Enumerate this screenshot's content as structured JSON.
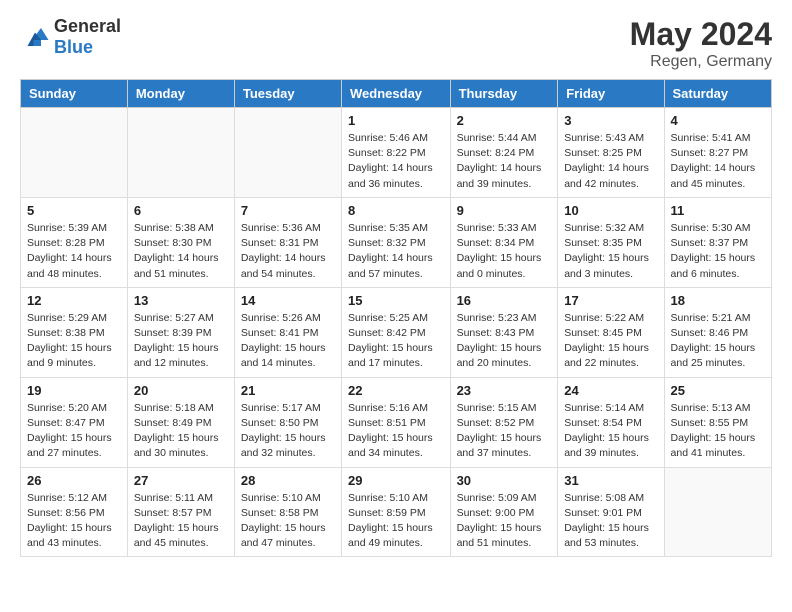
{
  "header": {
    "logo_general": "General",
    "logo_blue": "Blue",
    "month_year": "May 2024",
    "location": "Regen, Germany"
  },
  "weekdays": [
    "Sunday",
    "Monday",
    "Tuesday",
    "Wednesday",
    "Thursday",
    "Friday",
    "Saturday"
  ],
  "weeks": [
    [
      {
        "day": "",
        "info": ""
      },
      {
        "day": "",
        "info": ""
      },
      {
        "day": "",
        "info": ""
      },
      {
        "day": "1",
        "info": "Sunrise: 5:46 AM\nSunset: 8:22 PM\nDaylight: 14 hours\nand 36 minutes."
      },
      {
        "day": "2",
        "info": "Sunrise: 5:44 AM\nSunset: 8:24 PM\nDaylight: 14 hours\nand 39 minutes."
      },
      {
        "day": "3",
        "info": "Sunrise: 5:43 AM\nSunset: 8:25 PM\nDaylight: 14 hours\nand 42 minutes."
      },
      {
        "day": "4",
        "info": "Sunrise: 5:41 AM\nSunset: 8:27 PM\nDaylight: 14 hours\nand 45 minutes."
      }
    ],
    [
      {
        "day": "5",
        "info": "Sunrise: 5:39 AM\nSunset: 8:28 PM\nDaylight: 14 hours\nand 48 minutes."
      },
      {
        "day": "6",
        "info": "Sunrise: 5:38 AM\nSunset: 8:30 PM\nDaylight: 14 hours\nand 51 minutes."
      },
      {
        "day": "7",
        "info": "Sunrise: 5:36 AM\nSunset: 8:31 PM\nDaylight: 14 hours\nand 54 minutes."
      },
      {
        "day": "8",
        "info": "Sunrise: 5:35 AM\nSunset: 8:32 PM\nDaylight: 14 hours\nand 57 minutes."
      },
      {
        "day": "9",
        "info": "Sunrise: 5:33 AM\nSunset: 8:34 PM\nDaylight: 15 hours\nand 0 minutes."
      },
      {
        "day": "10",
        "info": "Sunrise: 5:32 AM\nSunset: 8:35 PM\nDaylight: 15 hours\nand 3 minutes."
      },
      {
        "day": "11",
        "info": "Sunrise: 5:30 AM\nSunset: 8:37 PM\nDaylight: 15 hours\nand 6 minutes."
      }
    ],
    [
      {
        "day": "12",
        "info": "Sunrise: 5:29 AM\nSunset: 8:38 PM\nDaylight: 15 hours\nand 9 minutes."
      },
      {
        "day": "13",
        "info": "Sunrise: 5:27 AM\nSunset: 8:39 PM\nDaylight: 15 hours\nand 12 minutes."
      },
      {
        "day": "14",
        "info": "Sunrise: 5:26 AM\nSunset: 8:41 PM\nDaylight: 15 hours\nand 14 minutes."
      },
      {
        "day": "15",
        "info": "Sunrise: 5:25 AM\nSunset: 8:42 PM\nDaylight: 15 hours\nand 17 minutes."
      },
      {
        "day": "16",
        "info": "Sunrise: 5:23 AM\nSunset: 8:43 PM\nDaylight: 15 hours\nand 20 minutes."
      },
      {
        "day": "17",
        "info": "Sunrise: 5:22 AM\nSunset: 8:45 PM\nDaylight: 15 hours\nand 22 minutes."
      },
      {
        "day": "18",
        "info": "Sunrise: 5:21 AM\nSunset: 8:46 PM\nDaylight: 15 hours\nand 25 minutes."
      }
    ],
    [
      {
        "day": "19",
        "info": "Sunrise: 5:20 AM\nSunset: 8:47 PM\nDaylight: 15 hours\nand 27 minutes."
      },
      {
        "day": "20",
        "info": "Sunrise: 5:18 AM\nSunset: 8:49 PM\nDaylight: 15 hours\nand 30 minutes."
      },
      {
        "day": "21",
        "info": "Sunrise: 5:17 AM\nSunset: 8:50 PM\nDaylight: 15 hours\nand 32 minutes."
      },
      {
        "day": "22",
        "info": "Sunrise: 5:16 AM\nSunset: 8:51 PM\nDaylight: 15 hours\nand 34 minutes."
      },
      {
        "day": "23",
        "info": "Sunrise: 5:15 AM\nSunset: 8:52 PM\nDaylight: 15 hours\nand 37 minutes."
      },
      {
        "day": "24",
        "info": "Sunrise: 5:14 AM\nSunset: 8:54 PM\nDaylight: 15 hours\nand 39 minutes."
      },
      {
        "day": "25",
        "info": "Sunrise: 5:13 AM\nSunset: 8:55 PM\nDaylight: 15 hours\nand 41 minutes."
      }
    ],
    [
      {
        "day": "26",
        "info": "Sunrise: 5:12 AM\nSunset: 8:56 PM\nDaylight: 15 hours\nand 43 minutes."
      },
      {
        "day": "27",
        "info": "Sunrise: 5:11 AM\nSunset: 8:57 PM\nDaylight: 15 hours\nand 45 minutes."
      },
      {
        "day": "28",
        "info": "Sunrise: 5:10 AM\nSunset: 8:58 PM\nDaylight: 15 hours\nand 47 minutes."
      },
      {
        "day": "29",
        "info": "Sunrise: 5:10 AM\nSunset: 8:59 PM\nDaylight: 15 hours\nand 49 minutes."
      },
      {
        "day": "30",
        "info": "Sunrise: 5:09 AM\nSunset: 9:00 PM\nDaylight: 15 hours\nand 51 minutes."
      },
      {
        "day": "31",
        "info": "Sunrise: 5:08 AM\nSunset: 9:01 PM\nDaylight: 15 hours\nand 53 minutes."
      },
      {
        "day": "",
        "info": ""
      }
    ]
  ]
}
